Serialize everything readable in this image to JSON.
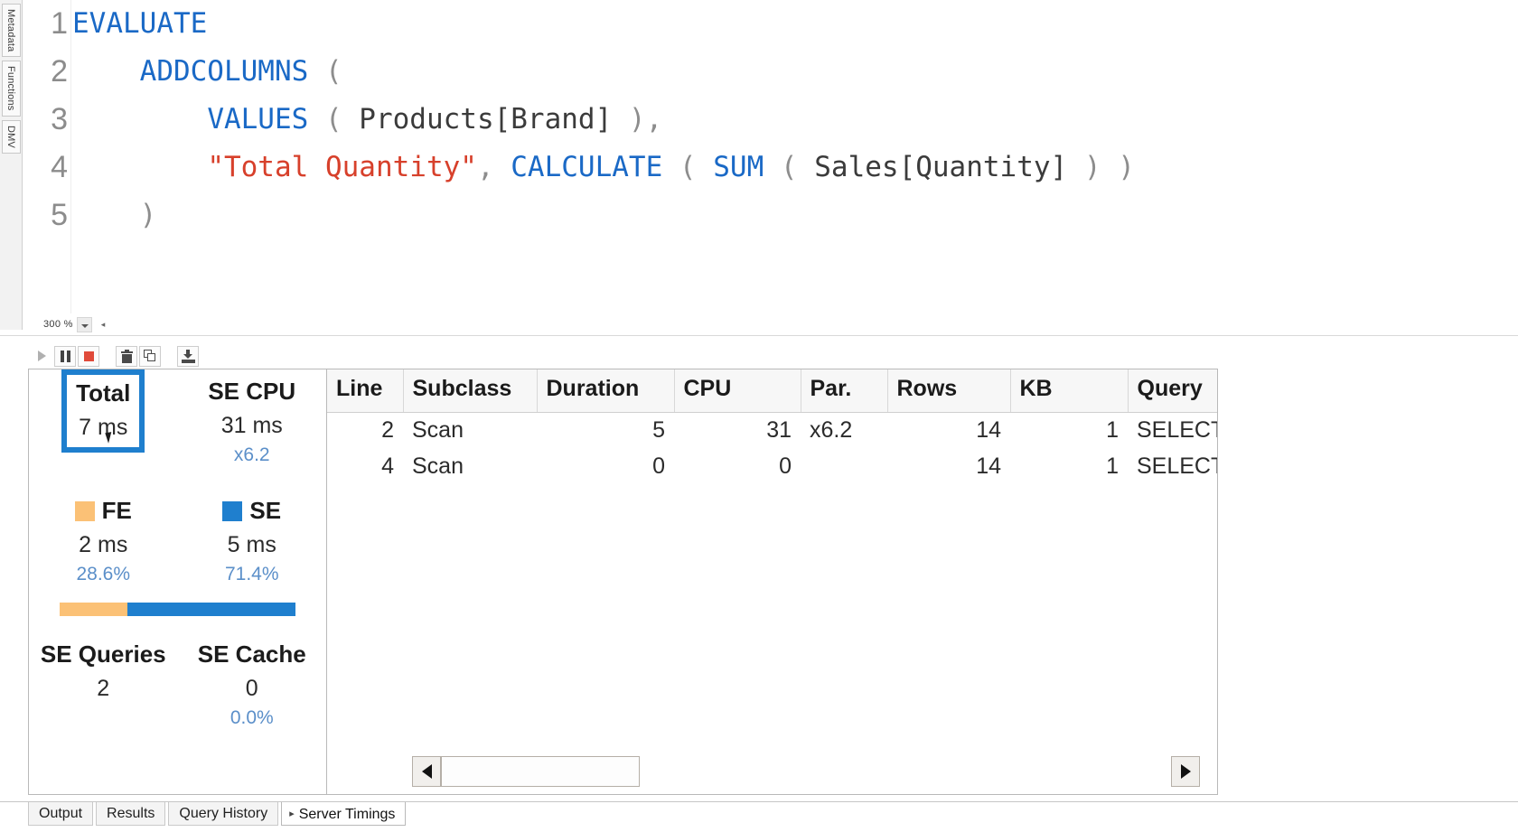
{
  "sidebar": {
    "tabs": [
      {
        "label": "Metadata",
        "name": "metadata"
      },
      {
        "label": "Functions",
        "name": "functions"
      },
      {
        "label": "DMV",
        "name": "dmv"
      }
    ]
  },
  "editor": {
    "zoom_level": "300 %",
    "lines": [
      {
        "number": "1",
        "tokens": [
          {
            "t": "EVALUATE",
            "c": "kw"
          }
        ]
      },
      {
        "number": "2",
        "tokens": [
          {
            "t": "    ",
            "c": "pun"
          },
          {
            "t": "ADDCOLUMNS",
            "c": "kw"
          },
          {
            "t": " (",
            "c": "pun"
          }
        ]
      },
      {
        "number": "3",
        "tokens": [
          {
            "t": "        ",
            "c": "pun"
          },
          {
            "t": "VALUES",
            "c": "kw"
          },
          {
            "t": " ( ",
            "c": "pun"
          },
          {
            "t": "Products[Brand]",
            "c": "idn"
          },
          {
            "t": " ),",
            "c": "pun"
          }
        ]
      },
      {
        "number": "4",
        "tokens": [
          {
            "t": "        ",
            "c": "pun"
          },
          {
            "t": "\"Total Quantity\"",
            "c": "str"
          },
          {
            "t": ", ",
            "c": "pun"
          },
          {
            "t": "CALCULATE",
            "c": "kw"
          },
          {
            "t": " ( ",
            "c": "pun"
          },
          {
            "t": "SUM",
            "c": "kw"
          },
          {
            "t": " ( ",
            "c": "pun"
          },
          {
            "t": "Sales[Quantity]",
            "c": "idn"
          },
          {
            "t": " ) )",
            "c": "pun"
          }
        ]
      },
      {
        "number": "5",
        "tokens": [
          {
            "t": "    )",
            "c": "pun"
          }
        ]
      }
    ]
  },
  "timings_toolbar": {
    "buttons": [
      {
        "name": "run-trace-button",
        "icon": "play-icon",
        "title": "Run",
        "enabled": false
      },
      {
        "name": "pause-trace-button",
        "icon": "pause-icon",
        "title": "Pause",
        "enabled": true
      },
      {
        "name": "stop-trace-button",
        "icon": "stop-icon",
        "title": "Stop",
        "enabled": true
      },
      {
        "name": "clear-trace-button",
        "icon": "trash-icon",
        "title": "Clear",
        "enabled": true
      },
      {
        "name": "copy-trace-button",
        "icon": "copy-icon",
        "title": "Copy",
        "enabled": true
      },
      {
        "name": "export-trace-button",
        "icon": "export-icon",
        "title": "Export",
        "enabled": true
      }
    ]
  },
  "metrics": {
    "total": {
      "label": "Total",
      "value": "7 ms",
      "highlighted": true
    },
    "se_cpu": {
      "label": "SE CPU",
      "value": "31 ms",
      "sub": "x6.2"
    },
    "fe": {
      "label": "FE",
      "value": "2 ms",
      "sub": "28.6%",
      "color": "#fbc176",
      "percent": 28.6
    },
    "se": {
      "label": "SE",
      "value": "5 ms",
      "sub": "71.4%",
      "color": "#1f7fce",
      "percent": 71.4
    },
    "se_queries": {
      "label": "SE Queries",
      "value": "2",
      "sub": ""
    },
    "se_cache": {
      "label": "SE Cache",
      "value": "0",
      "sub": "0.0%"
    }
  },
  "grid": {
    "columns": [
      "Line",
      "Subclass",
      "Duration",
      "CPU",
      "Par.",
      "Rows",
      "KB",
      "Query"
    ],
    "rows": [
      {
        "line": "2",
        "subclass": "Scan",
        "duration": "5",
        "cpu": "31",
        "par": "x6.2",
        "rows": "14",
        "kb": "1",
        "query": "SELECT"
      },
      {
        "line": "4",
        "subclass": "Scan",
        "duration": "0",
        "cpu": "0",
        "par": "",
        "rows": "14",
        "kb": "1",
        "query": "SELECT"
      }
    ]
  },
  "bottom_tabs": [
    {
      "label": "Output",
      "active": false,
      "pinned": false
    },
    {
      "label": "Results",
      "active": false,
      "pinned": false
    },
    {
      "label": "Query History",
      "active": false,
      "pinned": false
    },
    {
      "label": "Server Timings",
      "active": true,
      "pinned": true
    }
  ],
  "colors": {
    "accent_blue": "#1f7fce",
    "fe_orange": "#fbc176",
    "keyword_blue": "#1a69c6",
    "string_red": "#d7402b"
  }
}
